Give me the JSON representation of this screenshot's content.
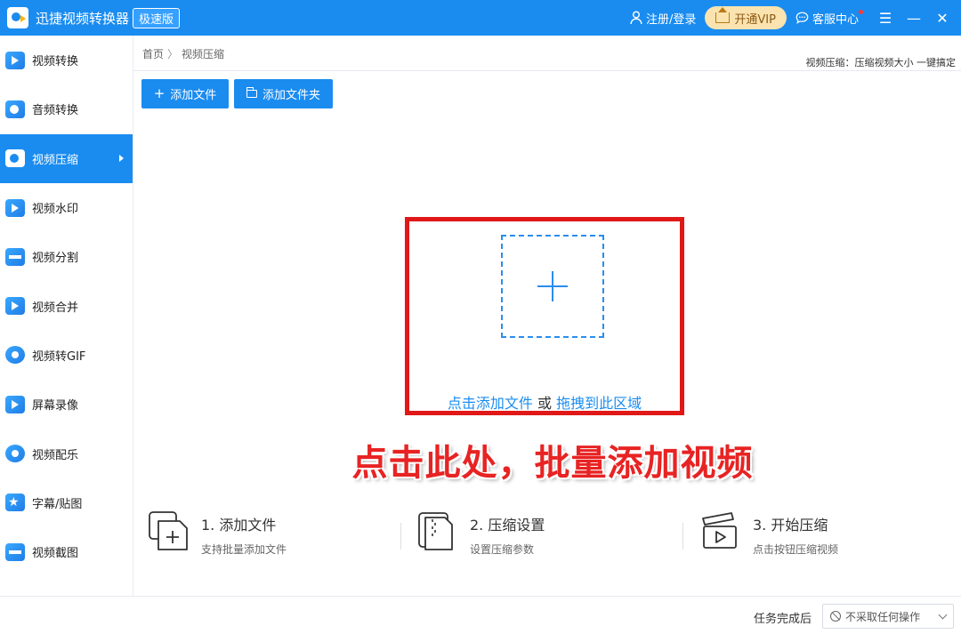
{
  "titlebar": {
    "app_name": "迅捷视频转换器",
    "edition": "极速版",
    "login": "注册/登录",
    "vip": "开通VIP",
    "service": "客服中心"
  },
  "sidebar": {
    "items": [
      {
        "label": "视频转换",
        "icon": "video-convert-icon"
      },
      {
        "label": "音频转换",
        "icon": "audio-convert-icon"
      },
      {
        "label": "视频压缩",
        "icon": "video-compress-icon",
        "active": true
      },
      {
        "label": "视频水印",
        "icon": "video-watermark-icon"
      },
      {
        "label": "视频分割",
        "icon": "video-split-icon"
      },
      {
        "label": "视频合并",
        "icon": "video-merge-icon"
      },
      {
        "label": "视频转GIF",
        "icon": "video-to-gif-icon"
      },
      {
        "label": "屏幕录像",
        "icon": "screen-record-icon"
      },
      {
        "label": "视频配乐",
        "icon": "video-music-icon"
      },
      {
        "label": "字幕/贴图",
        "icon": "subtitle-sticker-icon"
      },
      {
        "label": "视频截图",
        "icon": "video-screenshot-icon"
      }
    ]
  },
  "main": {
    "breadcrumb": {
      "home": "首页",
      "sep": "〉",
      "current": "视频压缩"
    },
    "tagline": "视频压缩：压缩视频大小 一键搞定",
    "buttons": {
      "add_file": "添加文件",
      "add_folder": "添加文件夹"
    },
    "dropzone": {
      "click_text": "点击添加文件",
      "or_text": " 或 ",
      "drag_text": "拖拽到此区域"
    },
    "annotation": "点击此处，批量添加视频",
    "steps": [
      {
        "title": "1. 添加文件",
        "desc": "支持批量添加文件"
      },
      {
        "title": "2. 压缩设置",
        "desc": "设置压缩参数"
      },
      {
        "title": "3. 开始压缩",
        "desc": "点击按钮压缩视频"
      }
    ]
  },
  "footer": {
    "label": "任务完成后",
    "select_value": "不采取任何操作"
  },
  "colors": {
    "primary": "#1a8cf0",
    "highlight": "#e01818"
  }
}
